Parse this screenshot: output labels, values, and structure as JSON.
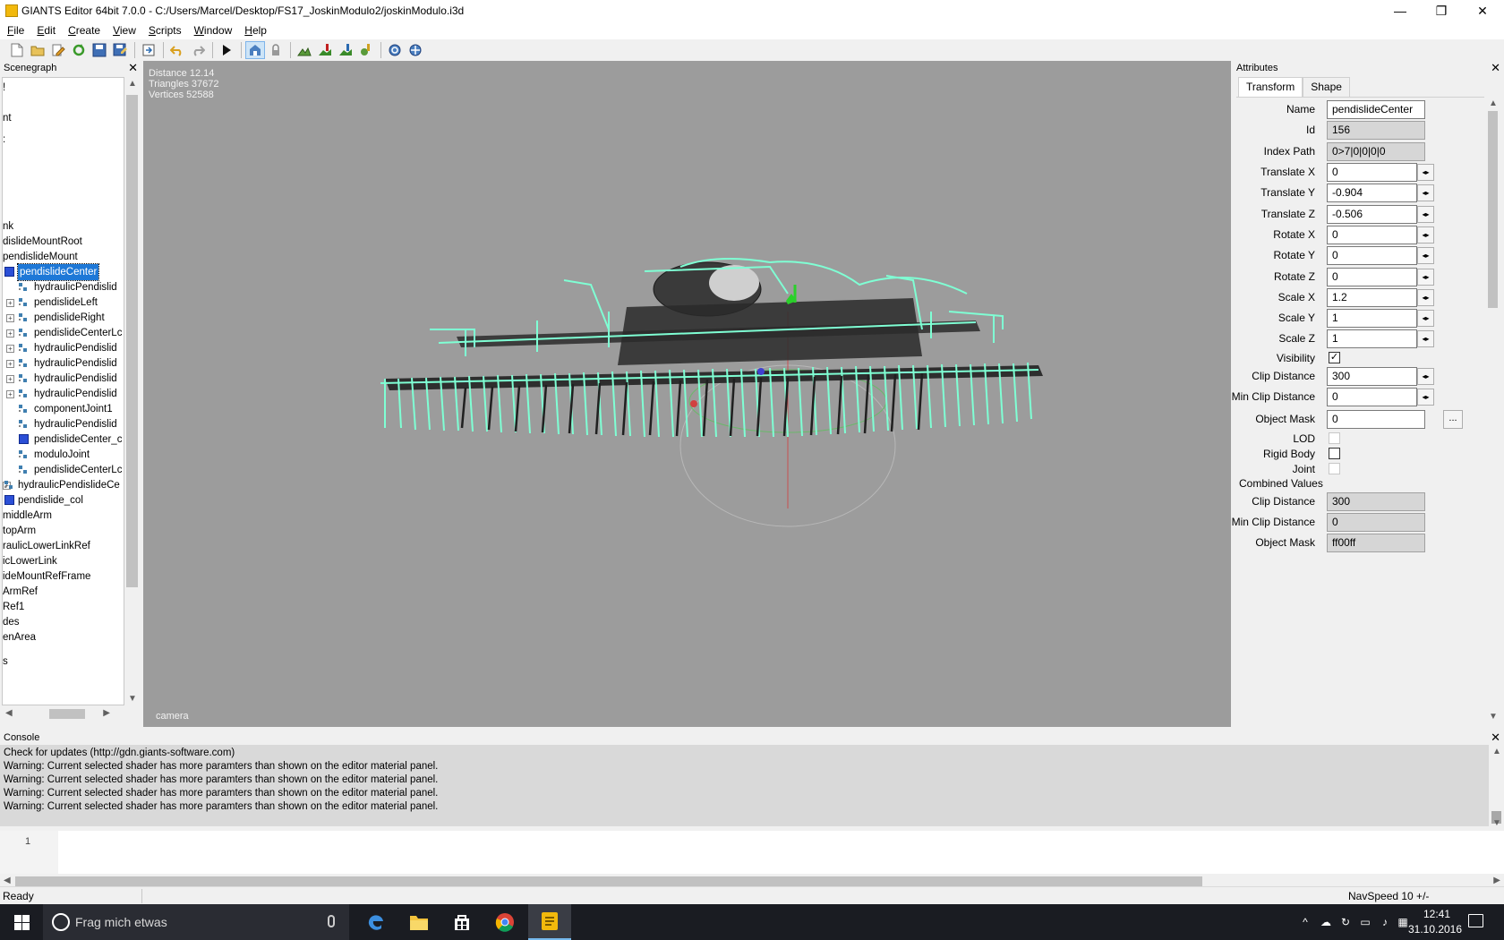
{
  "window": {
    "title": "GIANTS Editor 64bit 7.0.0 - C:/Users/Marcel/Desktop/FS17_JoskinModulo2/joskinModulo.i3d",
    "minimize": "—",
    "restore": "❐",
    "close": "✕"
  },
  "menu": [
    "File",
    "Edit",
    "Create",
    "View",
    "Scripts",
    "Window",
    "Help"
  ],
  "toolbar": {
    "icons": [
      "new-file-icon",
      "open-file-icon",
      "edit-file-icon",
      "reload-icon",
      "save-icon",
      "save-as-icon",
      "export-icon",
      "undo-icon",
      "redo-icon",
      "play-icon",
      "select-mode-icon",
      "lock-icon",
      "terrain-sculpt-icon",
      "terrain-paint-icon",
      "foliage-paint-icon",
      "placement-icon",
      "refresh-icon",
      "settings-icon"
    ]
  },
  "scenegraph": {
    "title": "Scenegraph",
    "close": "✕",
    "rows": [
      {
        "label": "!",
        "indent": 0,
        "icon": "none"
      },
      {
        "label": "nt",
        "indent": 0,
        "icon": "none"
      },
      {
        "label": ":",
        "indent": 0,
        "icon": "none"
      },
      {
        "label": "nk",
        "indent": 0,
        "icon": "none"
      },
      {
        "label": "dislideMountRoot",
        "indent": 0,
        "icon": "none"
      },
      {
        "label": "pendislideMount",
        "indent": 0,
        "icon": "none"
      },
      {
        "label": "pendislideCenter",
        "indent": 1,
        "icon": "cube",
        "selected": true
      },
      {
        "label": "hydraulicPendislid",
        "indent": 2,
        "icon": "node"
      },
      {
        "label": "pendislideLeft",
        "indent": 2,
        "icon": "node",
        "expand": true
      },
      {
        "label": "pendislideRight",
        "indent": 2,
        "icon": "node",
        "expand": true
      },
      {
        "label": "pendislideCenterLc",
        "indent": 2,
        "icon": "node",
        "expand": true
      },
      {
        "label": "hydraulicPendislid",
        "indent": 2,
        "icon": "node",
        "expand": true
      },
      {
        "label": "hydraulicPendislid",
        "indent": 2,
        "icon": "node",
        "expand": true
      },
      {
        "label": "hydraulicPendislid",
        "indent": 2,
        "icon": "node",
        "expand": true
      },
      {
        "label": "hydraulicPendislid",
        "indent": 2,
        "icon": "node",
        "expand": true
      },
      {
        "label": "componentJoint1",
        "indent": 2,
        "icon": "node"
      },
      {
        "label": "hydraulicPendislid",
        "indent": 2,
        "icon": "node"
      },
      {
        "label": "pendislideCenter_c",
        "indent": 2,
        "icon": "cube"
      },
      {
        "label": "moduloJoint",
        "indent": 2,
        "icon": "node"
      },
      {
        "label": "pendislideCenterLc",
        "indent": 2,
        "icon": "node"
      },
      {
        "label": "hydraulicPendislideCe",
        "indent": 1,
        "icon": "node",
        "expand": true
      },
      {
        "label": "pendislide_col",
        "indent": 1,
        "icon": "cube"
      },
      {
        "label": "middleArm",
        "indent": 0,
        "icon": "none"
      },
      {
        "label": "topArm",
        "indent": 0,
        "icon": "none"
      },
      {
        "label": "raulicLowerLinkRef",
        "indent": 0,
        "icon": "none"
      },
      {
        "label": "icLowerLink",
        "indent": 0,
        "icon": "none"
      },
      {
        "label": "ideMountRefFrame",
        "indent": 0,
        "icon": "none"
      },
      {
        "label": "ArmRef",
        "indent": 0,
        "icon": "none"
      },
      {
        "label": "Ref1",
        "indent": 0,
        "icon": "none"
      },
      {
        "label": "des",
        "indent": 0,
        "icon": "none"
      },
      {
        "label": "enArea",
        "indent": 0,
        "icon": "none"
      },
      {
        "label": "s",
        "indent": 0,
        "icon": "none"
      }
    ]
  },
  "viewport": {
    "stats": [
      "Distance 12.14",
      "Triangles 37672",
      "Vertices 52588"
    ],
    "camera_label": "camera"
  },
  "attributes": {
    "title": "Attributes",
    "close": "✕",
    "tabs": [
      "Transform",
      "Shape"
    ],
    "name_label": "Name",
    "name_value": "pendislideCenter",
    "id_label": "Id",
    "id_value": "156",
    "index_path_label": "Index Path",
    "index_path_value": "0>7|0|0|0|0",
    "fields": [
      {
        "label": "Translate X",
        "value": "0"
      },
      {
        "label": "Translate Y",
        "value": "-0.904"
      },
      {
        "label": "Translate Z",
        "value": "-0.506"
      },
      {
        "label": "Rotate X",
        "value": "0"
      },
      {
        "label": "Rotate Y",
        "value": "0"
      },
      {
        "label": "Rotate Z",
        "value": "0"
      },
      {
        "label": "Scale X",
        "value": "1.2"
      },
      {
        "label": "Scale Y",
        "value": "1"
      },
      {
        "label": "Scale Z",
        "value": "1"
      }
    ],
    "visibility_label": "Visibility",
    "visibility_checked": true,
    "clip_distance_label": "Clip Distance",
    "clip_distance_value": "300",
    "min_clip_label": "Min Clip Distance",
    "min_clip_value": "0",
    "object_mask_label": "Object Mask",
    "object_mask_value": "0",
    "dots": "...",
    "lod_label": "LOD",
    "rigid_body_label": "Rigid Body",
    "joint_label": "Joint",
    "combined_label": "Combined Values",
    "combined_clip_label": "Clip Distance",
    "combined_clip_value": "300",
    "combined_min_clip_label": "Min Clip Distance",
    "combined_min_clip_value": "0",
    "combined_mask_label": "Object Mask",
    "combined_mask_value": "ff00ff",
    "spin_glyph": "◂▸"
  },
  "console": {
    "title": "Console",
    "close": "✕",
    "lines": [
      "Check for updates (http://gdn.giants-software.com)",
      "Warning: Current selected shader has more paramters than shown on the editor material panel.",
      "Warning: Current selected shader has more paramters than shown on the editor material panel.",
      "Warning: Current selected shader has more paramters than shown on the editor material panel.",
      "Warning: Current selected shader has more paramters than shown on the editor material panel."
    ],
    "line_number": "1"
  },
  "status": {
    "text": "Ready",
    "navspeed": "NavSpeed 10 +/-"
  },
  "taskbar": {
    "search_placeholder": "Frag mich etwas",
    "time": "12:41",
    "date": "31.10.2016",
    "apps": [
      "edge-icon",
      "file-explorer-icon",
      "store-icon",
      "chrome-icon",
      "giants-editor-icon"
    ]
  },
  "colors": {
    "viewport_bg": "#9c9c9c",
    "selection": "#1e78d7",
    "wireframe": "#7fffd4",
    "taskbar": "#1a1c22"
  }
}
